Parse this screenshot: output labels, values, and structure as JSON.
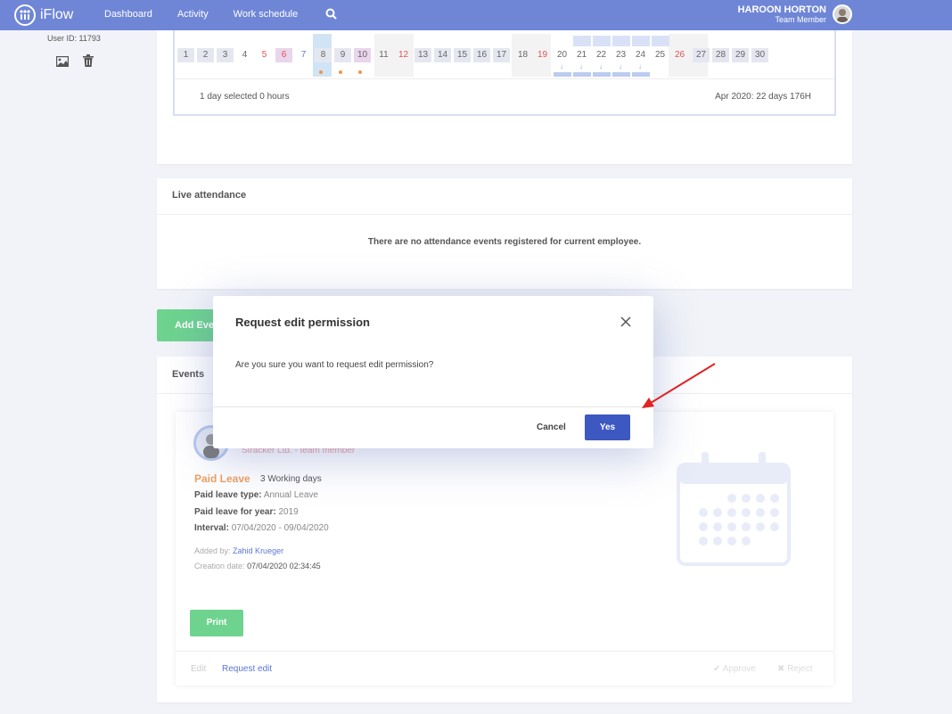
{
  "brand": {
    "name": "iFlow"
  },
  "nav": {
    "items": [
      "Dashboard",
      "Activity",
      "Work schedule"
    ]
  },
  "user": {
    "name": "HAROON HORTON",
    "role": "Team Member",
    "id_label": "User ID: 11793"
  },
  "calendar": {
    "days": [
      "1",
      "2",
      "3",
      "4",
      "5",
      "6",
      "7",
      "8",
      "9",
      "10",
      "11",
      "12",
      "13",
      "14",
      "15",
      "16",
      "17",
      "18",
      "19",
      "20",
      "21",
      "22",
      "23",
      "24",
      "25",
      "26",
      "27",
      "28",
      "29",
      "30"
    ],
    "selected_summary": "1 day selected 0 hours",
    "month_summary": "Apr 2020: 22 days 176H"
  },
  "live_attendance": {
    "title": "Live attendance",
    "empty_message": "There are no attendance events registered for current employee."
  },
  "add_event_button": "Add Eve",
  "events": {
    "title": "Events",
    "company": "Stracker Ltd. - team member",
    "event_type": "Paid Leave",
    "working_days": "3 Working days",
    "leave_type_label": "Paid leave type:",
    "leave_type_value": "Annual Leave",
    "leave_year_label": "Paid leave for year:",
    "leave_year_value": "2019",
    "interval_label": "Interval:",
    "interval_value": "07/04/2020 - 09/04/2020",
    "added_by_label": "Added by:",
    "added_by_value": "Zahid Krueger",
    "creation_label": "Creation date:",
    "creation_value": "07/04/2020 02:34:45",
    "print": "Print",
    "edit": "Edit",
    "request_edit": "Request edit",
    "approve": "Approve",
    "reject": "Reject"
  },
  "modal": {
    "title": "Request edit permission",
    "body": "Are you sure you want to request edit permission?",
    "cancel": "Cancel",
    "confirm": "Yes"
  },
  "colors": {
    "topbar": "#6f86d6",
    "primary": "#3d58c0",
    "success": "#6ed38f",
    "annotation": "#e02424"
  }
}
